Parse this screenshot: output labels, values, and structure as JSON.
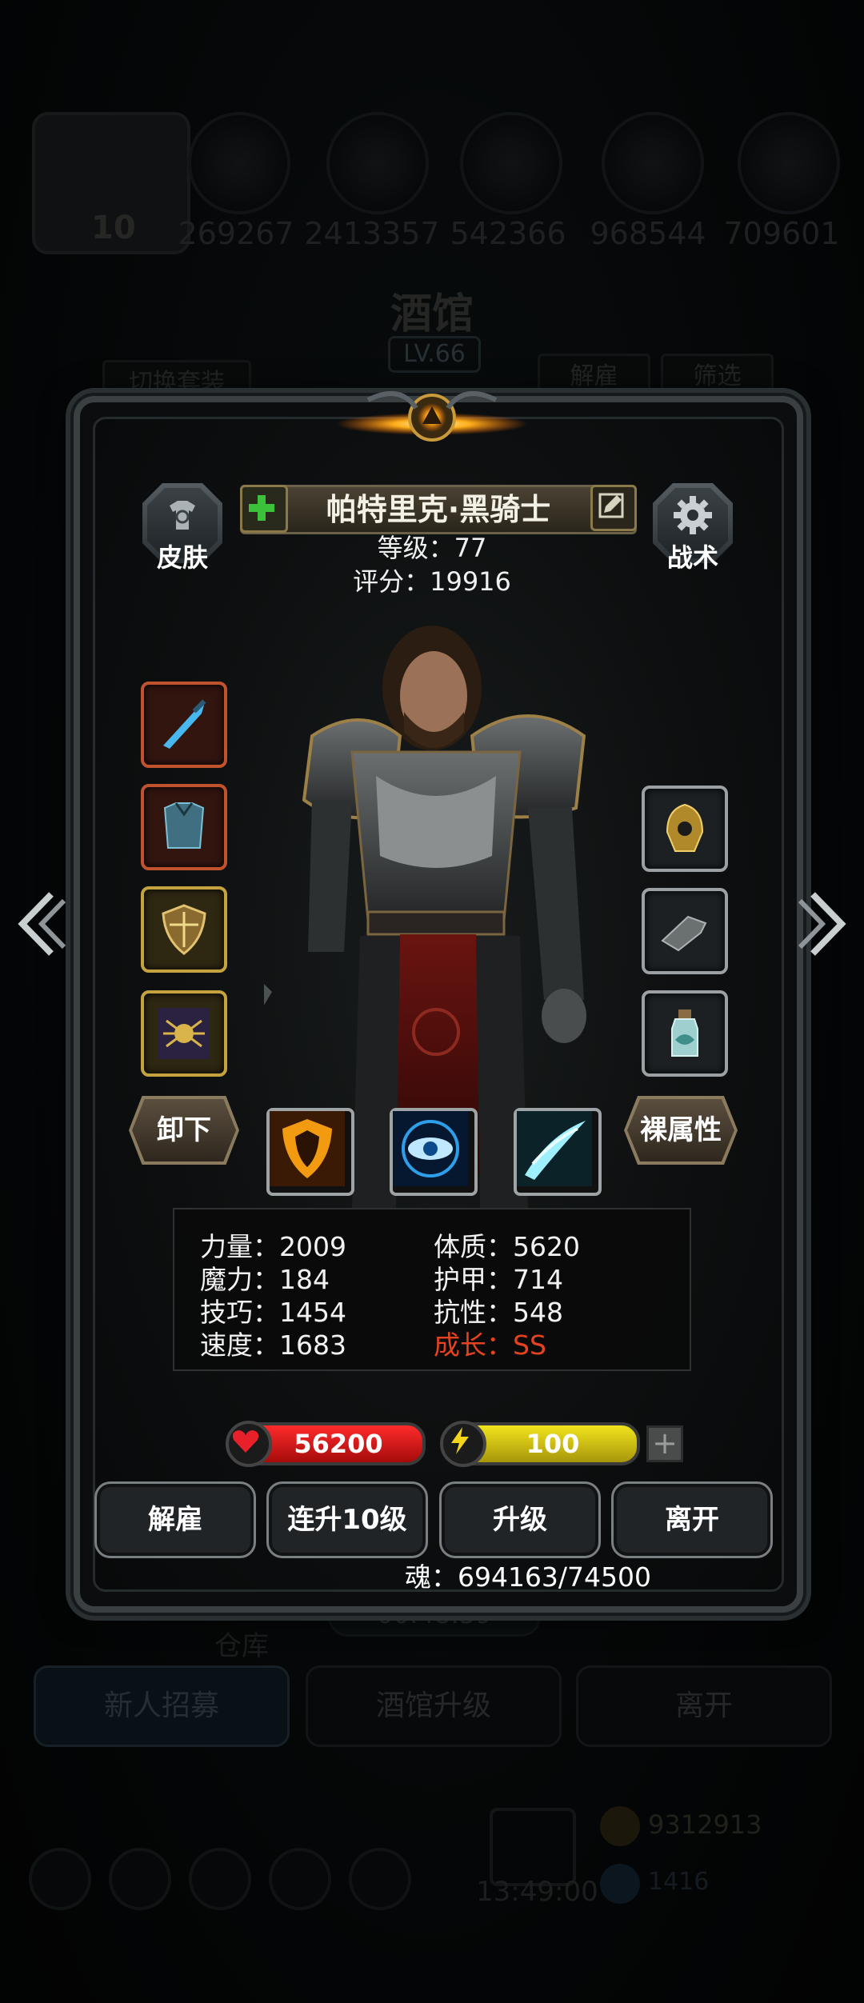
{
  "background": {
    "level_badge": "10",
    "resources": [
      "269267",
      "2413357",
      "542366",
      "968544",
      "709601"
    ],
    "tavern_title": "酒馆",
    "tavern_level": "LV.66",
    "switch_set_label": "切换套装",
    "dismiss_label": "解雇",
    "filter_label": "筛选",
    "warehouse_label": "仓库",
    "timer": "00:48:59",
    "bottom_tabs": [
      "新人招募",
      "酒馆升级",
      "离开"
    ],
    "clock": "13:49:00",
    "gold": "9312913",
    "gems": "1416"
  },
  "hero": {
    "name": "帕特里克·黑骑士",
    "level_line": "等级：77",
    "score_line": "评分：19916",
    "skin_label": "皮肤",
    "tactics_label": "战术",
    "unequip_label": "卸下",
    "bare_attr_label": "裸属性"
  },
  "stats": {
    "strength": "力量：2009",
    "magic": "魔力：184",
    "skill": "技巧：1454",
    "speed": "速度：1683",
    "constitution": "体质：5620",
    "armor": "护甲：714",
    "resistance": "抗性：548",
    "growth": "成长：SS"
  },
  "bars": {
    "hp": "56200",
    "energy": "100"
  },
  "actions": [
    "解雇",
    "连升10级",
    "升级",
    "离开"
  ],
  "soul_line": "魂：694163/74500",
  "colors": {
    "growth": "#e5421f",
    "hp": "#e01b1b",
    "energy": "#e6d51a"
  }
}
